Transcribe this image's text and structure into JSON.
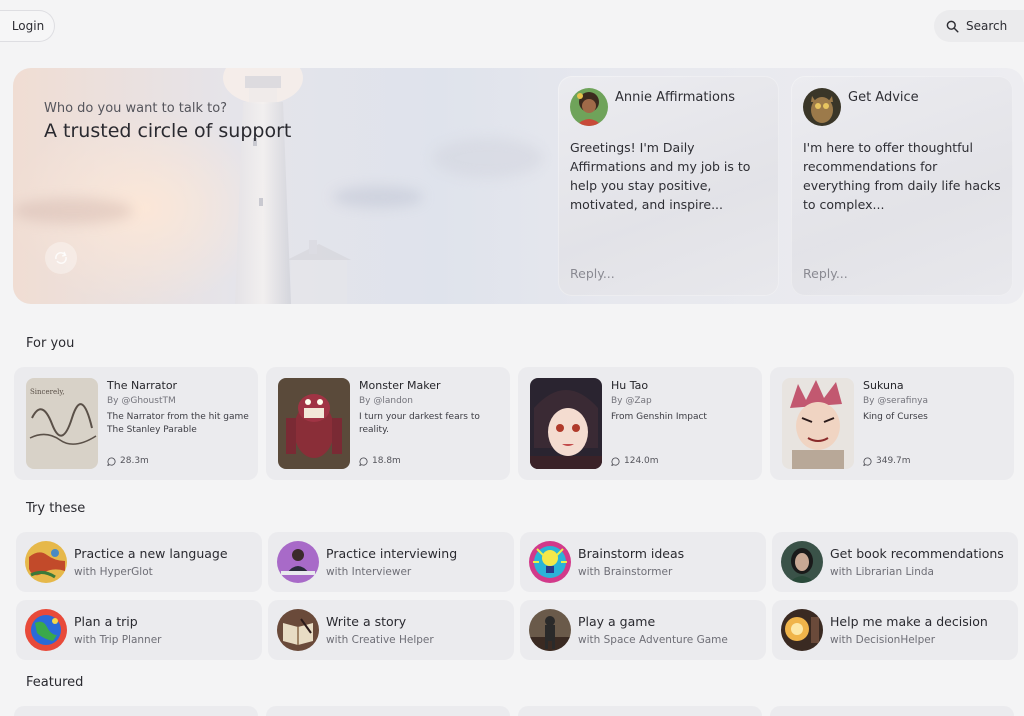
{
  "header": {
    "login_label": "Login",
    "search_label": "Search"
  },
  "hero": {
    "subtitle": "Who do you want to talk to?",
    "title": "A trusted circle of support",
    "chats": [
      {
        "name": "Annie Affirmations",
        "message": "Greetings! I'm Daily Affirmations and my job is to help you stay positive, motivated, and inspire...",
        "reply_placeholder": "Reply..."
      },
      {
        "name": "Get Advice",
        "message": "I'm here to offer thoughtful recommendations for everything from daily life hacks to complex...",
        "reply_placeholder": "Reply..."
      }
    ]
  },
  "for_you": {
    "title": "For you",
    "characters": [
      {
        "name": "The Narrator",
        "by": "By @GhoustTM",
        "description": "The Narrator from the hit game The Stanley Parable",
        "count": "28.3m"
      },
      {
        "name": "Monster Maker",
        "by": "By @landon",
        "description": "I turn your darkest fears to reality.",
        "count": "18.8m"
      },
      {
        "name": "Hu Tao",
        "by": "By @Zap",
        "description": "From Genshin Impact",
        "count": "124.0m"
      },
      {
        "name": "Sukuna",
        "by": "By @serafinya",
        "description": "King of Curses",
        "count": "349.7m"
      }
    ]
  },
  "try_these": {
    "title": "Try these",
    "items": [
      {
        "title": "Practice a new language",
        "subtitle": "with HyperGlot"
      },
      {
        "title": "Practice interviewing",
        "subtitle": "with Interviewer"
      },
      {
        "title": "Brainstorm ideas",
        "subtitle": "with Brainstormer"
      },
      {
        "title": "Get book recommendations",
        "subtitle": "with Librarian Linda"
      },
      {
        "title": "Plan a trip",
        "subtitle": "with Trip Planner"
      },
      {
        "title": "Write a story",
        "subtitle": "with Creative Helper"
      },
      {
        "title": "Play a game",
        "subtitle": "with Space Adventure Game"
      },
      {
        "title": "Help me make a decision",
        "subtitle": "with DecisionHelper"
      }
    ]
  },
  "featured": {
    "title": "Featured"
  }
}
